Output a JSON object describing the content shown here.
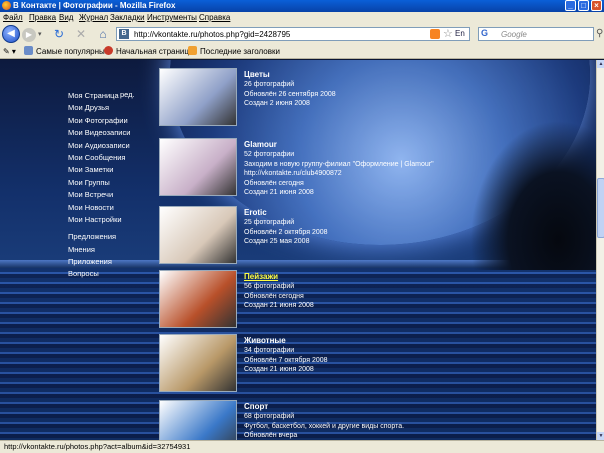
{
  "window": {
    "title": "В Контакте | Фотографии - Mozilla Firefox"
  },
  "menu": [
    "Файл",
    "Правка",
    "Вид",
    "Журнал",
    "Закладки",
    "Инструменты",
    "Справка"
  ],
  "nav": {
    "url": "http://vkontakte.ru/photos.php?gid=2428795",
    "site_icon_letter": "В",
    "language": "En",
    "search_placeholder": "Google",
    "search_engine_letter": "G"
  },
  "bookmarks": [
    "Самые популярные",
    "Начальная страница",
    "Последние заголовки"
  ],
  "left_menu": {
    "edit_label": "ред.",
    "primary": [
      "Моя Страница",
      "Мои Друзья",
      "Мои Фотографии",
      "Мои Видеозаписи",
      "Мои Аудиозаписи",
      "Мои Сообщения",
      "Мои Заметки",
      "Мои Группы",
      "Мои Встречи",
      "Мои Новости",
      "Мои Настройки"
    ],
    "secondary": [
      "Предложения",
      "Мнения",
      "Приложения",
      "Вопросы"
    ]
  },
  "albums": [
    {
      "title": "Цветы",
      "lines": [
        "26 фотографий",
        "Обновлён 26 сентября 2008",
        "Создан 2 июня 2008"
      ],
      "color": "#8fa0c8"
    },
    {
      "title": "Glamour",
      "lines": [
        "52 фотографии",
        "Заходим в новую группу-филиал \"Оформление | Glamour\"",
        "http://vkontakte.ru/club4900872",
        "Обновлён сегодня",
        "Создан 21 июня 2008"
      ],
      "color": "#c8b0c8"
    },
    {
      "title": "Erotic",
      "lines": [
        "25 фотографий",
        "Обновлён 2 октября 2008",
        "Создан 25 мая 2008"
      ],
      "color": "#d8c8b8"
    },
    {
      "title": "Пейзажи",
      "lines": [
        "56 фотографий",
        "Обновлён сегодня",
        "Создан 21 июня 2008"
      ],
      "color": "#b8502a",
      "highlight": true
    },
    {
      "title": "Животные",
      "lines": [
        "34 фотографии",
        "Обновлён 7 октября 2008",
        "Создан 21 июня 2008"
      ],
      "color": "#b89868"
    },
    {
      "title": "Спорт",
      "lines": [
        "68 фотографий",
        "Футбол, баскетбол, хоккей и другие виды спорта.",
        "Обновлён вчера"
      ],
      "color": "#3a78c8"
    }
  ],
  "status": {
    "text": "http://vkontakte.ru/photos.php?act=album&id=32754931"
  }
}
